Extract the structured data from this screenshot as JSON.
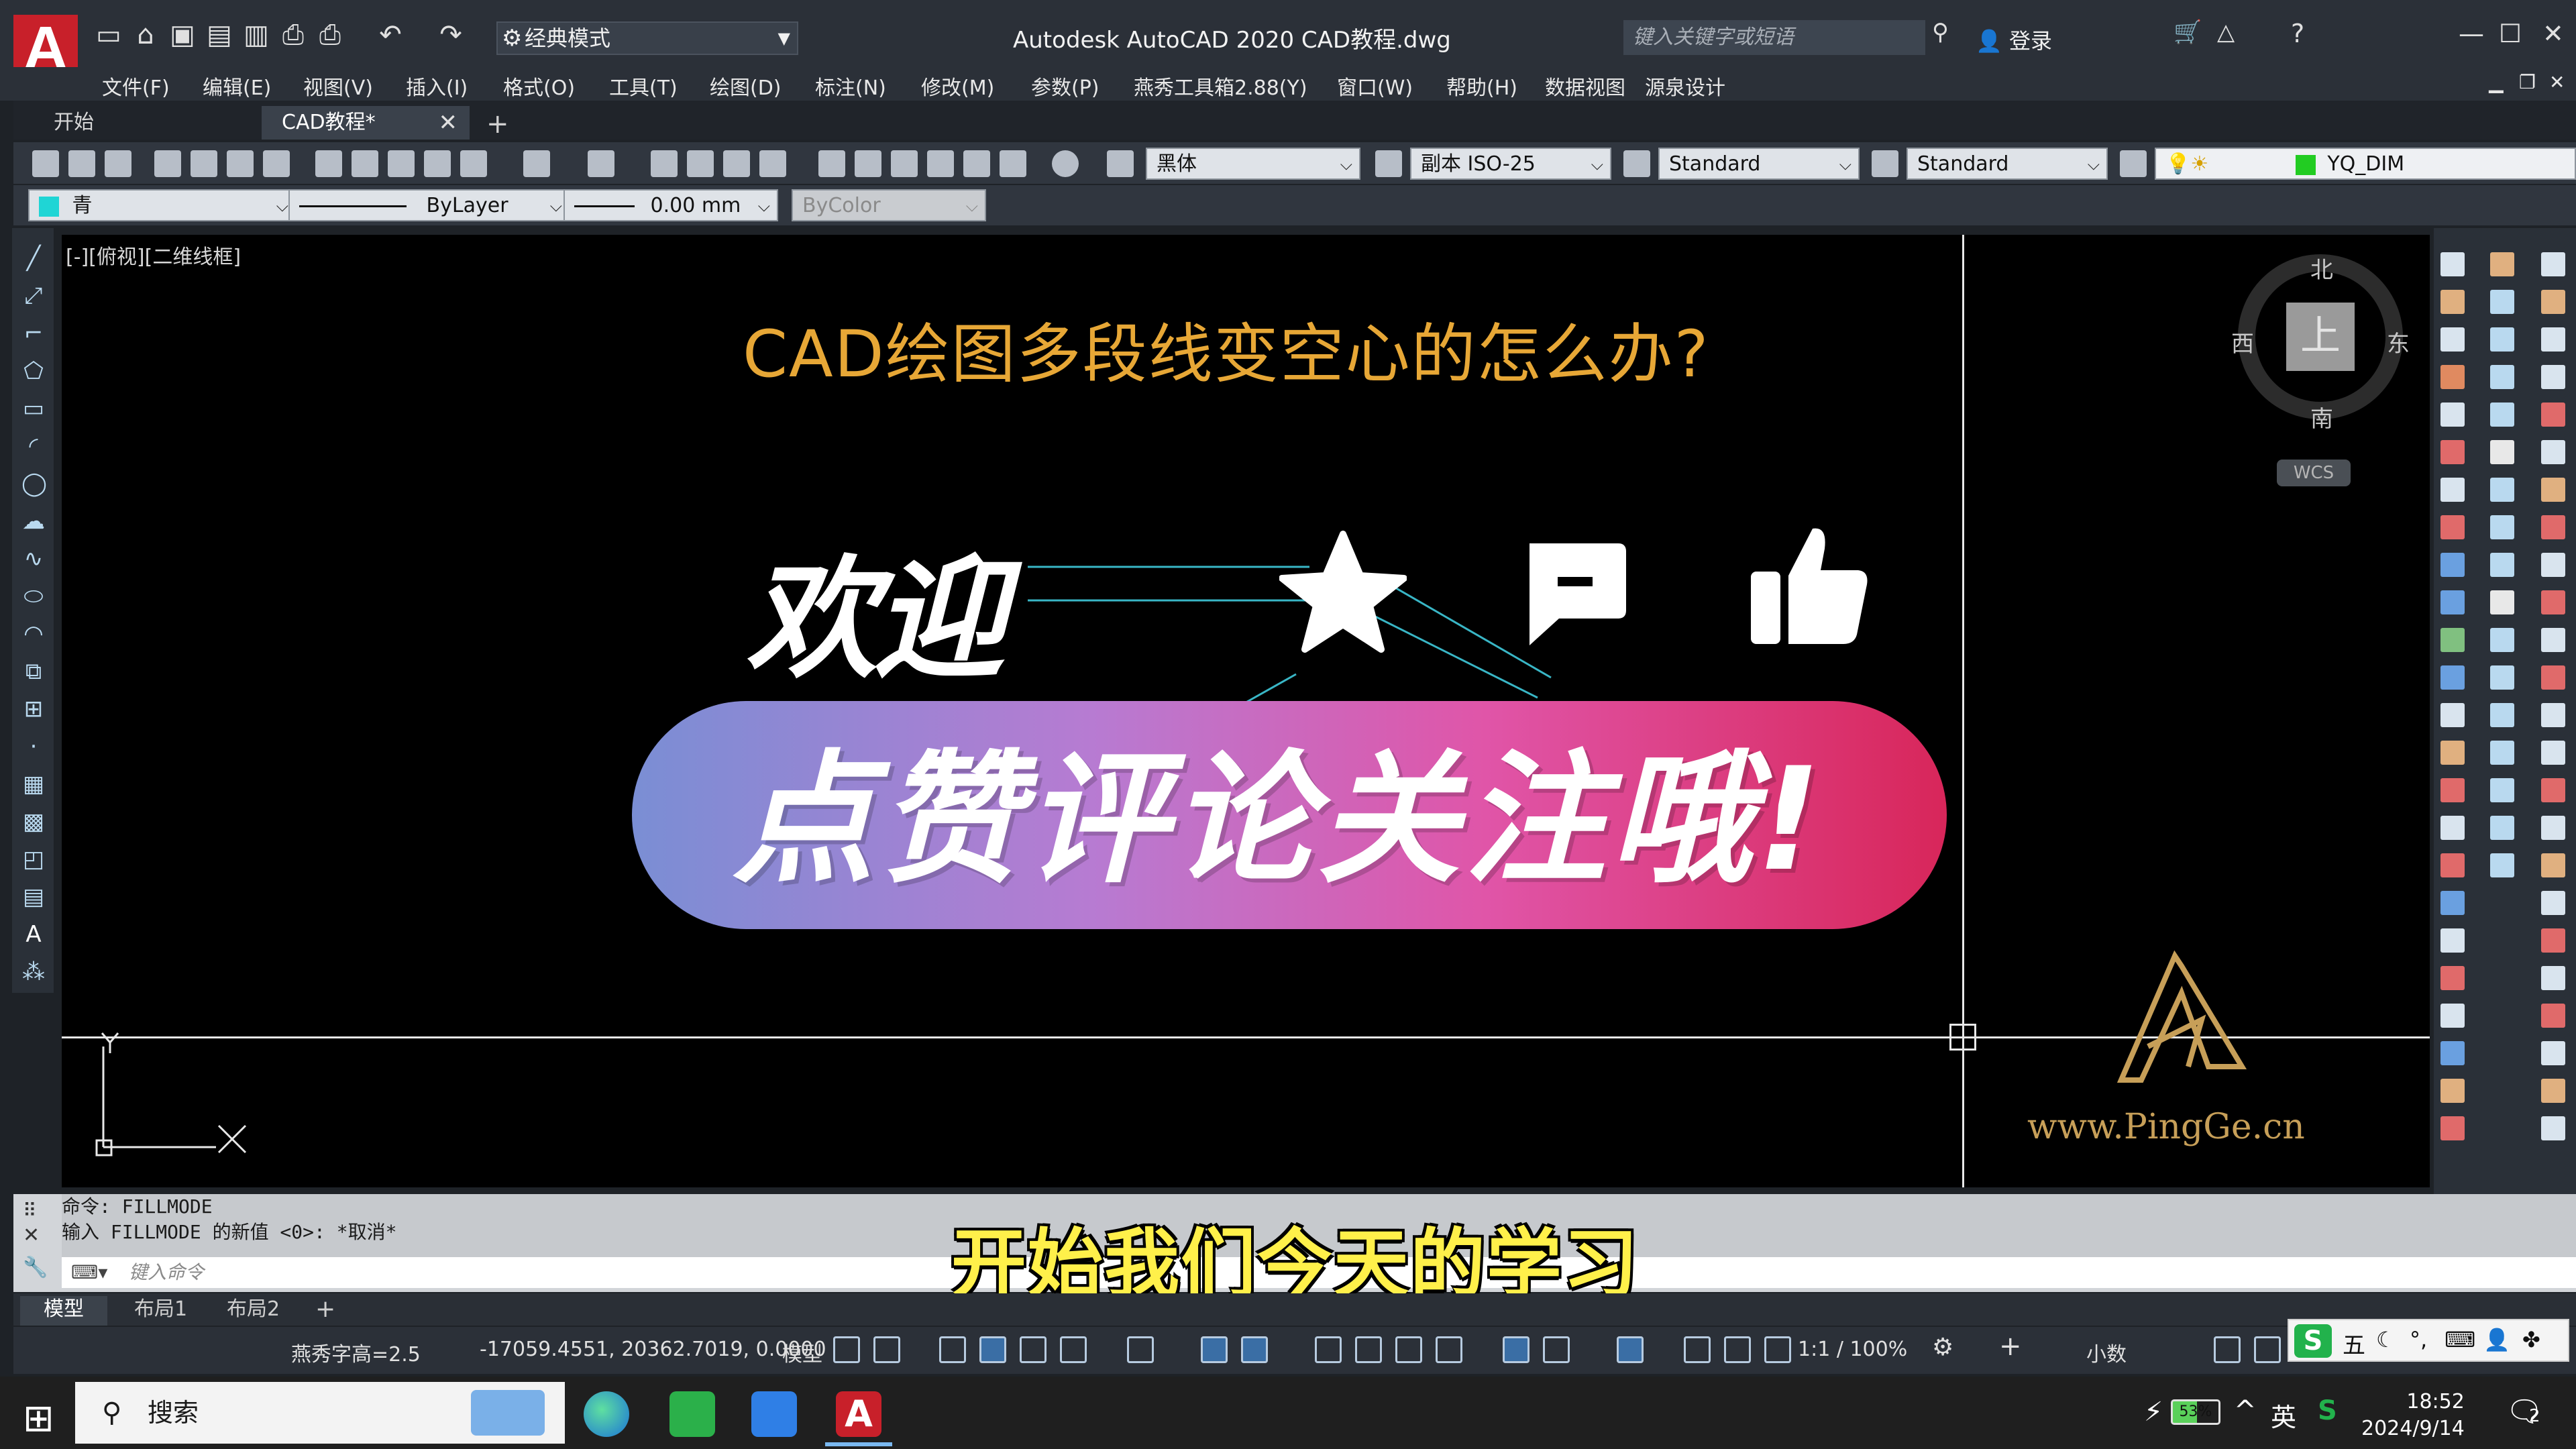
{
  "titlebar": {
    "app_logo": "A",
    "workspace": "经典模式",
    "title": "Autodesk AutoCAD 2020    CAD教程.dwg",
    "search_placeholder": "键入关键字或短语",
    "login": "登录"
  },
  "menu": [
    "文件(F)",
    "编辑(E)",
    "视图(V)",
    "插入(I)",
    "格式(O)",
    "工具(T)",
    "绘图(D)",
    "标注(N)",
    "修改(M)",
    "参数(P)",
    "燕秀工具箱2.88(Y)",
    "窗口(W)",
    "帮助(H)",
    "数据视图",
    "源泉设计"
  ],
  "tabs": {
    "start": "开始",
    "drawing": "CAD教程*"
  },
  "toolbar": {
    "text_font": "黑体",
    "dim_style": "副本 ISO-25",
    "table_style": "Standard",
    "multileader_style": "Standard",
    "layer": "YQ_DIM",
    "color": "青",
    "linetype": "ByLayer",
    "lineweight": "0.00 mm",
    "plotstyle": "ByColor"
  },
  "canvas": {
    "view_label": "[-][俯视][二维线框]",
    "headline": "CAD绘图多段线变空心的怎么办?",
    "welcome": "欢迎",
    "banner": "点赞评论关注哦!",
    "ucs_x": "X",
    "ucs_y": "Y",
    "brand_url": "www.PingGe.cn",
    "viewcube": {
      "n": "北",
      "s": "南",
      "e": "东",
      "w": "西",
      "face": "上",
      "wcs": "WCS"
    }
  },
  "command": {
    "history": [
      "命令: FILLMODE",
      "输入 FILLMODE 的新值 <0>: *取消*"
    ],
    "placeholder": "键入命令"
  },
  "subtitle": "开始我们今天的学习",
  "layout_tabs": [
    "模型",
    "布局1",
    "布局2"
  ],
  "status": {
    "text_height": "燕秀字高=2.5",
    "coords": "-17059.4551, 20362.7019, 0.0000",
    "space": "模型",
    "scale": "1:1 / 100%",
    "units": "小数"
  },
  "ime": [
    "五",
    "☾",
    "°,",
    "⌨"
  ],
  "taskbar": {
    "search": "搜索",
    "battery": "53%",
    "lang": "英",
    "time": "18:52",
    "date": "2024/9/14",
    "notifications": "2"
  },
  "colors": {
    "accent_red": "#c8202a",
    "headline": "#e7a736",
    "subtitle": "#fff04a",
    "brand": "#c79f58",
    "layer_color": "#1fd5d5"
  }
}
